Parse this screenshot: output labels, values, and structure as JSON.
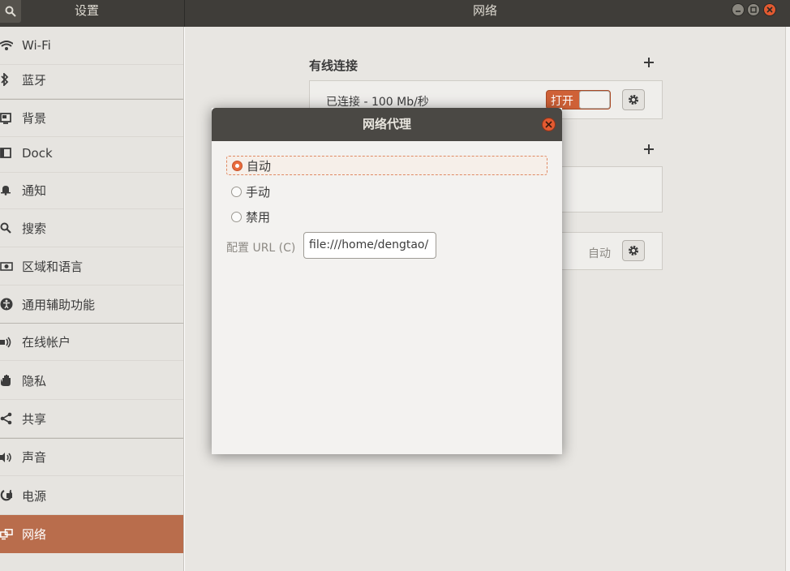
{
  "titlebar": {
    "left_title": "设置",
    "main_title": "网络"
  },
  "sidebar": {
    "items": [
      {
        "label": "Wi-Fi",
        "icon": "wifi-icon"
      },
      {
        "label": "蓝牙",
        "icon": "bluetooth-icon"
      },
      {
        "label": "背景",
        "icon": "background-icon"
      },
      {
        "label": "Dock",
        "icon": "dock-icon"
      },
      {
        "label": "通知",
        "icon": "bell-icon"
      },
      {
        "label": "搜索",
        "icon": "search-icon"
      },
      {
        "label": "区域和语言",
        "icon": "camera-icon"
      },
      {
        "label": "通用辅助功能",
        "icon": "accessibility-icon"
      },
      {
        "label": "在线帐户",
        "icon": "online-accounts-icon"
      },
      {
        "label": "隐私",
        "icon": "hand-icon"
      },
      {
        "label": "共享",
        "icon": "share-icon"
      },
      {
        "label": "声音",
        "icon": "speaker-icon"
      },
      {
        "label": "电源",
        "icon": "power-icon"
      },
      {
        "label": "网络",
        "icon": "network-icon"
      }
    ],
    "active": "网络"
  },
  "main": {
    "wired_title": "有线连接",
    "wired_status": "已连接 - 100 Mb/秒",
    "toggle_label": "打开",
    "proxy_value": "自动"
  },
  "dialog": {
    "title": "网络代理",
    "options": [
      "自动",
      "手动",
      "禁用"
    ],
    "selected": "自动",
    "url_label": "配置 URL (C)",
    "url_value": "file:///home/dengtao/"
  },
  "colors": {
    "accent": "#e96c3d",
    "active_sidebar": "#b96d4c",
    "titlebar": "#3f3d39"
  }
}
